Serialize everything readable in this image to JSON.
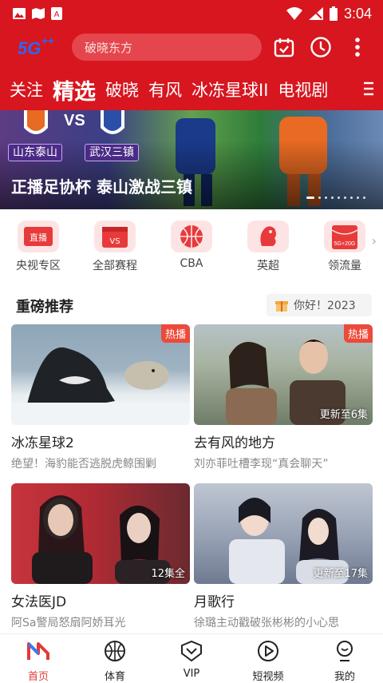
{
  "status_bar": {
    "time": "3:04"
  },
  "header": {
    "logo_text": "5G",
    "search_placeholder": "破晓东方"
  },
  "tabs": [
    {
      "label": "关注"
    },
    {
      "label": "精选",
      "active": true
    },
    {
      "label": "破晓"
    },
    {
      "label": "有风"
    },
    {
      "label": "冰冻星球II"
    },
    {
      "label": "电视剧"
    }
  ],
  "banner": {
    "title": "正播足协杯 泰山激战三镇",
    "vs_text": "VS",
    "team_left": "山东泰山",
    "team_right": "武汉三镇"
  },
  "categories": [
    {
      "label": "央视专区",
      "badge": "直播"
    },
    {
      "label": "全部赛程",
      "badge": "VS"
    },
    {
      "label": "CBA",
      "badge": ""
    },
    {
      "label": "英超",
      "badge": ""
    },
    {
      "label": "领流量",
      "badge": "5G+20G"
    }
  ],
  "section": {
    "title": "重磅推荐",
    "greeting": "你好！2023"
  },
  "cards": [
    {
      "title": "冰冻星球2",
      "subtitle": "绝望！海豹能否逃脱虎鲸围剿",
      "tag": "热播",
      "episodes": ""
    },
    {
      "title": "去有风的地方",
      "subtitle": "刘亦菲吐槽李现“真会聊天”",
      "tag": "热播",
      "episodes": "更新至6集"
    },
    {
      "title": "女法医JD",
      "subtitle": "阿Sa警局怒扇阿娇耳光",
      "tag": "",
      "episodes": "12集全"
    },
    {
      "title": "月歌行",
      "subtitle": "徐璐主动戳破张彬彬的小心思",
      "tag": "",
      "episodes": "更新至17集"
    }
  ],
  "bottom_nav": [
    {
      "label": "首页",
      "active": true,
      "icon": "home-icon"
    },
    {
      "label": "体育",
      "icon": "basketball-icon"
    },
    {
      "label": "VIP",
      "icon": "vip-icon"
    },
    {
      "label": "短视频",
      "icon": "play-icon"
    },
    {
      "label": "我的",
      "icon": "profile-icon"
    }
  ],
  "colors": {
    "brand": "#d7161f",
    "accent": "#e03a3a",
    "card_tag": "#ec4a3a"
  }
}
